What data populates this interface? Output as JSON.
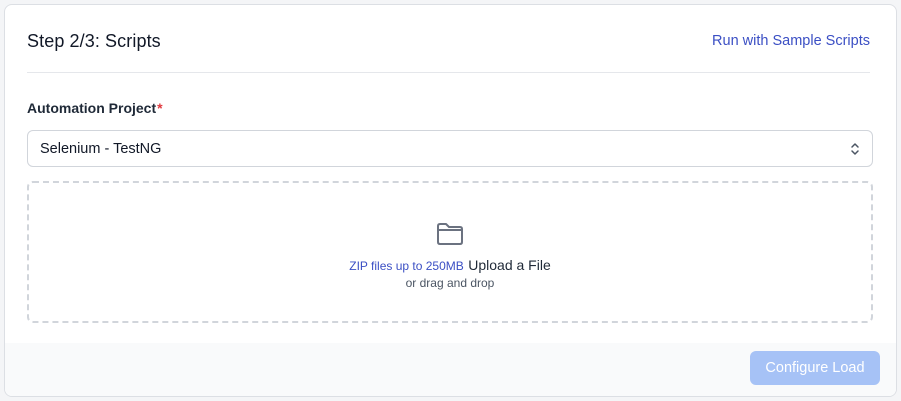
{
  "header": {
    "title": "Step 2/3: Scripts",
    "sample_link": "Run with Sample Scripts"
  },
  "project_field": {
    "label": "Automation Project",
    "required_mark": "*",
    "selected_value": "Selenium - TestNG"
  },
  "upload": {
    "hint": "ZIP files up to 250MB",
    "label": "Upload a File",
    "drag_text": "or drag and drop",
    "icon": "folder-icon"
  },
  "footer": {
    "configure_label": "Configure Load",
    "configure_disabled": true
  },
  "colors": {
    "accent": "#3b4fc4",
    "required": "#e0393e",
    "button_disabled": "#a6c2f6"
  }
}
